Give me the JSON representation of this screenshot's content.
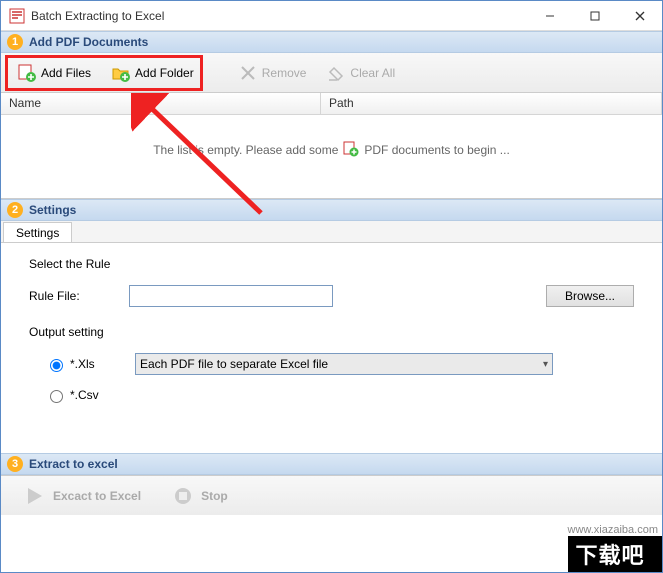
{
  "window": {
    "title": "Batch Extracting to Excel"
  },
  "section1": {
    "num": "1",
    "label": "Add PDF Documents"
  },
  "toolbar": {
    "add_files": "Add Files",
    "add_folder": "Add Folder",
    "remove": "Remove",
    "clear_all": "Clear All"
  },
  "list": {
    "col_name": "Name",
    "col_path": "Path",
    "empty_before": "The list is empty. Please add some",
    "empty_after": "PDF documents to begin ..."
  },
  "section2": {
    "num": "2",
    "label": "Settings"
  },
  "settings": {
    "tab": "Settings",
    "select_rule": "Select the Rule",
    "rule_file_label": "Rule File:",
    "rule_file_value": "",
    "browse": "Browse...",
    "output_setting": "Output setting",
    "xls_label": "*.Xls",
    "csv_label": "*.Csv",
    "dropdown_value": "Each PDF file to separate Excel file"
  },
  "section3": {
    "num": "3",
    "label": "Extract to excel"
  },
  "actions": {
    "extract": "Excact to Excel",
    "stop": "Stop"
  },
  "watermark": {
    "url": "www.xiazaiba.com",
    "text": "下载吧"
  }
}
